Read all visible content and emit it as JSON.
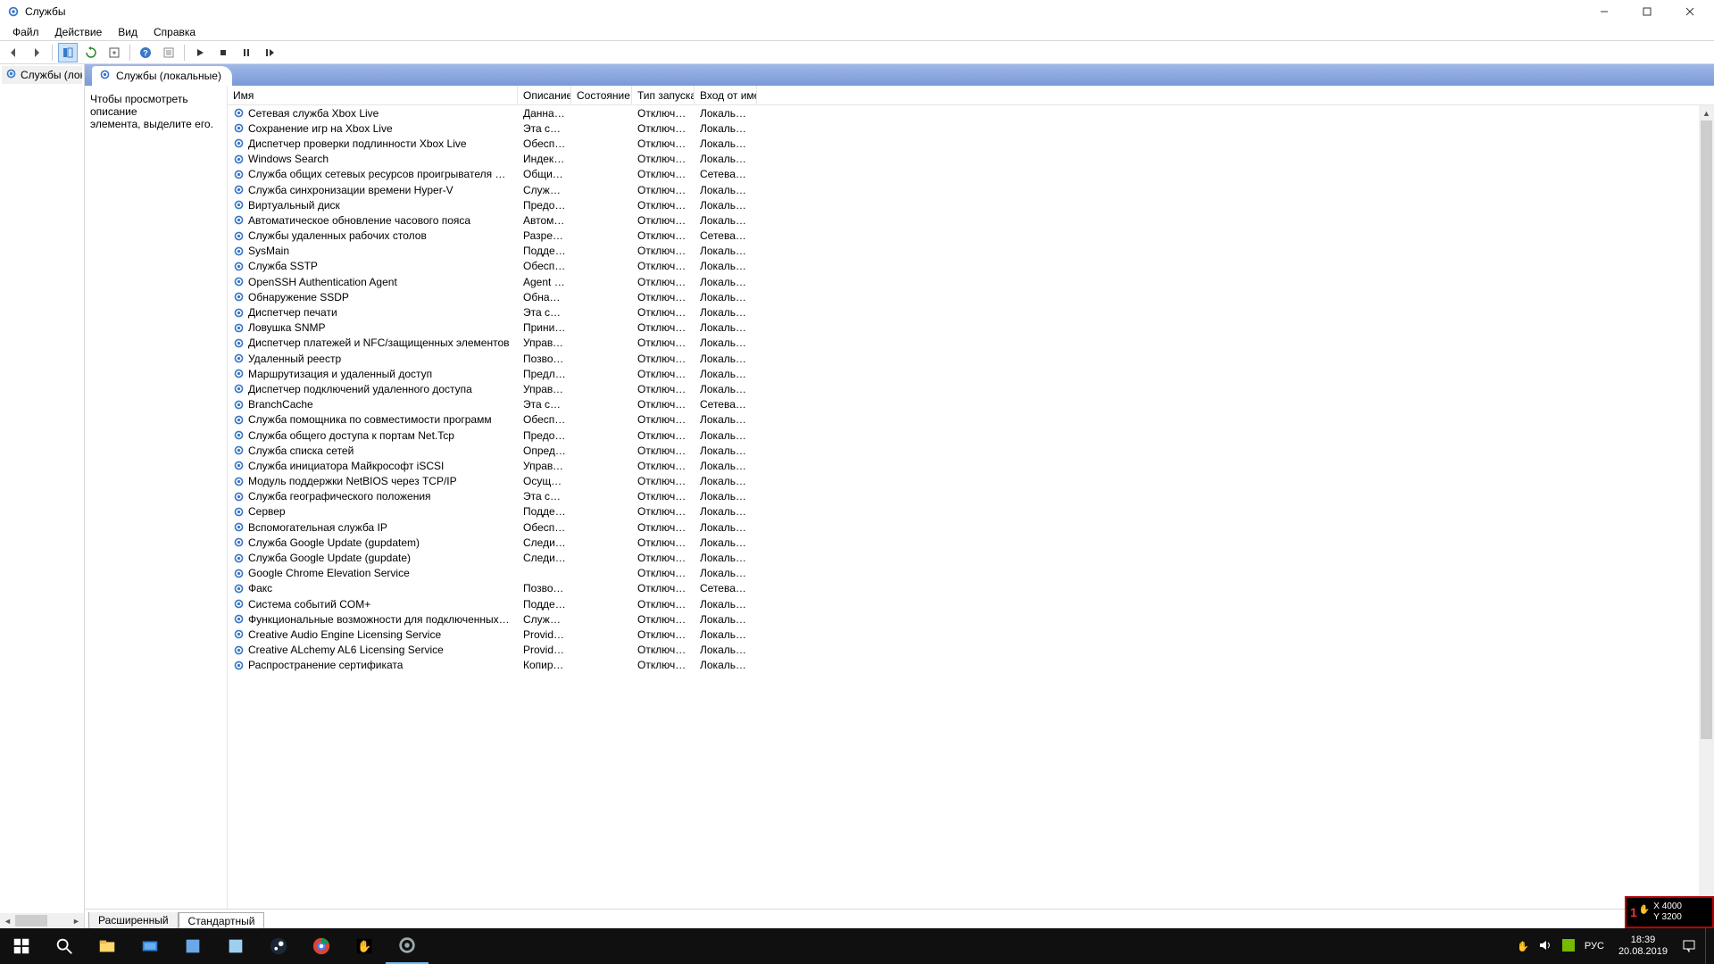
{
  "window": {
    "title": "Службы"
  },
  "menu": {
    "file": "Файл",
    "action": "Действие",
    "view": "Вид",
    "help": "Справка"
  },
  "tree": {
    "item": "Службы (локал"
  },
  "header_tab": "Службы (локальные)",
  "desc_panel": {
    "line1": "Чтобы просмотреть описание",
    "line2": "элемента, выделите его."
  },
  "columns": {
    "name": "Имя",
    "description": "Описание",
    "status": "Состояние",
    "startup": "Тип запуска",
    "logon": "Вход от име..."
  },
  "services": [
    {
      "name": "Сетевая служба Xbox Live",
      "desc": "Данная с...",
      "state": "",
      "startup": "Отключена",
      "logon": "Локальная с..."
    },
    {
      "name": "Сохранение игр на Xbox Live",
      "desc": "Эта служ...",
      "state": "",
      "startup": "Отключена",
      "logon": "Локальная с..."
    },
    {
      "name": "Диспетчер проверки подлинности Xbox Live",
      "desc": "Обеспеч...",
      "state": "",
      "startup": "Отключена",
      "logon": "Локальная с..."
    },
    {
      "name": "Windows Search",
      "desc": "Индекси...",
      "state": "",
      "startup": "Отключена",
      "logon": "Локальная с..."
    },
    {
      "name": "Служба общих сетевых ресурсов проигрывателя Windows Ме...",
      "desc": "Общий д...",
      "state": "",
      "startup": "Отключена",
      "logon": "Сетевая слу..."
    },
    {
      "name": "Служба синхронизации времени Hyper-V",
      "desc": "Служба с...",
      "state": "",
      "startup": "Отключена",
      "logon": "Локальная с..."
    },
    {
      "name": "Виртуальный диск",
      "desc": "Предост...",
      "state": "",
      "startup": "Отключена",
      "logon": "Локальная с..."
    },
    {
      "name": "Автоматическое обновление часового пояса",
      "desc": "Автомат...",
      "state": "",
      "startup": "Отключена",
      "logon": "Локальная с..."
    },
    {
      "name": "Службы удаленных рабочих столов",
      "desc": "Разреша...",
      "state": "",
      "startup": "Отключена",
      "logon": "Сетевая слу..."
    },
    {
      "name": "SysMain",
      "desc": "Поддерж...",
      "state": "",
      "startup": "Отключена",
      "logon": "Локальная с..."
    },
    {
      "name": "Служба SSTP",
      "desc": "Обеспеч...",
      "state": "",
      "startup": "Отключена",
      "logon": "Локальная с..."
    },
    {
      "name": "OpenSSH Authentication Agent",
      "desc": "Agent to ...",
      "state": "",
      "startup": "Отключена",
      "logon": "Локальная с..."
    },
    {
      "name": "Обнаружение SSDP",
      "desc": "Обнаруж...",
      "state": "",
      "startup": "Отключена",
      "logon": "Локальная с..."
    },
    {
      "name": "Диспетчер печати",
      "desc": "Эта служ...",
      "state": "",
      "startup": "Отключена",
      "logon": "Локальная с..."
    },
    {
      "name": "Ловушка SNMP",
      "desc": "Принима...",
      "state": "",
      "startup": "Отключена",
      "logon": "Локальная с..."
    },
    {
      "name": "Диспетчер платежей и NFC/защищенных элементов",
      "desc": "Управляе...",
      "state": "",
      "startup": "Отключена",
      "logon": "Локальная с..."
    },
    {
      "name": "Удаленный реестр",
      "desc": "Позволя...",
      "state": "",
      "startup": "Отключена",
      "logon": "Локальная с..."
    },
    {
      "name": "Маршрутизация и удаленный доступ",
      "desc": "Предлага...",
      "state": "",
      "startup": "Отключена",
      "logon": "Локальная с..."
    },
    {
      "name": "Диспетчер подключений удаленного доступа",
      "desc": "Управляе...",
      "state": "",
      "startup": "Отключена",
      "logon": "Локальная с..."
    },
    {
      "name": "BranchCache",
      "desc": "Эта служ...",
      "state": "",
      "startup": "Отключена",
      "logon": "Сетевая слу..."
    },
    {
      "name": "Служба помощника по совместимости программ",
      "desc": "Обеспеч...",
      "state": "",
      "startup": "Отключена",
      "logon": "Локальная с..."
    },
    {
      "name": "Служба общего доступа к портам Net.Tcp",
      "desc": "Предост...",
      "state": "",
      "startup": "Отключена",
      "logon": "Локальная с..."
    },
    {
      "name": "Служба списка сетей",
      "desc": "Определ...",
      "state": "",
      "startup": "Отключена",
      "logon": "Локальная с..."
    },
    {
      "name": "Служба инициатора Майкрософт iSCSI",
      "desc": "Управляе...",
      "state": "",
      "startup": "Отключена",
      "logon": "Локальная с..."
    },
    {
      "name": "Модуль поддержки NetBIOS через TCP/IP",
      "desc": "Осущест...",
      "state": "",
      "startup": "Отключена",
      "logon": "Локальная с..."
    },
    {
      "name": "Служба географического положения",
      "desc": "Эта служ...",
      "state": "",
      "startup": "Отключена",
      "logon": "Локальная с..."
    },
    {
      "name": "Сервер",
      "desc": "Поддерж...",
      "state": "",
      "startup": "Отключена",
      "logon": "Локальная с..."
    },
    {
      "name": "Вспомогательная служба IP",
      "desc": "Обеспеч...",
      "state": "",
      "startup": "Отключена",
      "logon": "Локальная с..."
    },
    {
      "name": "Служба Google Update (gupdatem)",
      "desc": "Следите ...",
      "state": "",
      "startup": "Отключена",
      "logon": "Локальная с..."
    },
    {
      "name": "Служба Google Update (gupdate)",
      "desc": "Следите ...",
      "state": "",
      "startup": "Отключена",
      "logon": "Локальная с..."
    },
    {
      "name": "Google Chrome Elevation Service",
      "desc": "",
      "state": "",
      "startup": "Отключена",
      "logon": "Локальная с..."
    },
    {
      "name": "Факс",
      "desc": "Позволя...",
      "state": "",
      "startup": "Отключена",
      "logon": "Сетевая слу..."
    },
    {
      "name": "Система событий COM+",
      "desc": "Поддерж...",
      "state": "",
      "startup": "Отключена",
      "logon": "Локальная с..."
    },
    {
      "name": "Функциональные возможности для подключенных пользоват...",
      "desc": "Служба ...",
      "state": "",
      "startup": "Отключена",
      "logon": "Локальная с..."
    },
    {
      "name": "Creative Audio Engine Licensing Service",
      "desc": "Provides l...",
      "state": "",
      "startup": "Отключена",
      "logon": "Локальная с..."
    },
    {
      "name": "Creative ALchemy AL6 Licensing Service",
      "desc": "Provides l...",
      "state": "",
      "startup": "Отключена",
      "logon": "Локальная с..."
    },
    {
      "name": "Распространение сертификата",
      "desc": "Копируе...",
      "state": "",
      "startup": "Отключена",
      "logon": "Локальная с..."
    }
  ],
  "bottom_tabs": {
    "extended": "Расширенный",
    "standard": "Стандартный"
  },
  "overlay": {
    "x": "X 4000",
    "y": "Y 3200"
  },
  "tray": {
    "lang": "РУС",
    "time": "18:39",
    "date": "20.08.2019"
  }
}
